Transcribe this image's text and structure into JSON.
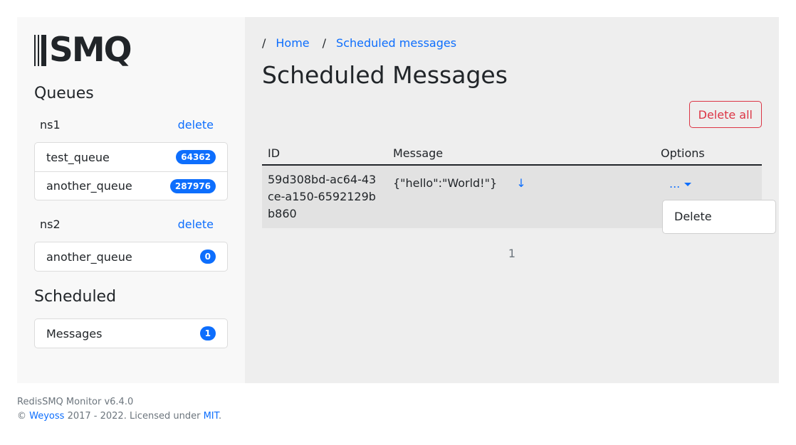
{
  "app": {
    "logo_text": "SMQ"
  },
  "sidebar": {
    "queues_heading": "Queues",
    "namespaces": [
      {
        "name": "ns1",
        "delete_label": "delete",
        "queues": [
          {
            "name": "test_queue",
            "count": "64362"
          },
          {
            "name": "another_queue",
            "count": "287976"
          }
        ]
      },
      {
        "name": "ns2",
        "delete_label": "delete",
        "queues": [
          {
            "name": "another_queue",
            "count": "0"
          }
        ]
      }
    ],
    "scheduled_heading": "Scheduled",
    "scheduled_items": [
      {
        "name": "Messages",
        "count": "1"
      }
    ]
  },
  "breadcrumb": {
    "separator": "/",
    "items": [
      "Home",
      "Scheduled messages"
    ]
  },
  "main": {
    "title": "Scheduled Messages",
    "delete_all_label": "Delete all",
    "table": {
      "headers": [
        "ID",
        "Message",
        "Options"
      ],
      "rows": [
        {
          "id": "59d308bd-ac64-43ce-a150-6592129bb860",
          "message": "{\"hello\":\"World!\"}",
          "expand_glyph": "↓",
          "options_label": "..."
        }
      ]
    },
    "dropdown": {
      "items": [
        "Delete"
      ]
    },
    "pagination": {
      "current_page": "1"
    }
  },
  "footer": {
    "line1": "RedisSMQ Monitor v6.4.0",
    "copyright_symbol": "©",
    "author": "Weyoss",
    "years_text": "2017 - 2022. Licensed under",
    "license": "MIT",
    "period": "."
  },
  "colors": {
    "accent": "#0d6efd",
    "danger": "#dc3545",
    "sidebar_bg": "#f8f8f8",
    "main_bg": "#eeeeee"
  }
}
